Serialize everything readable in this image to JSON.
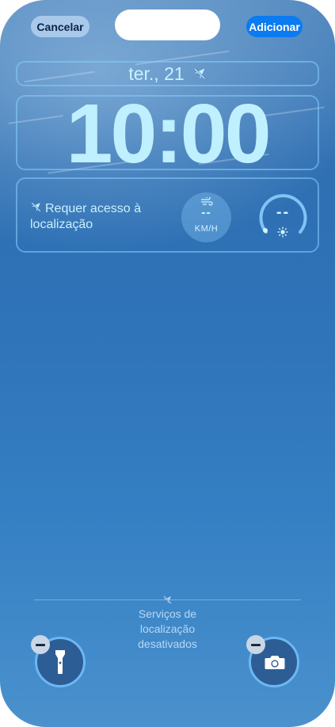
{
  "header": {
    "cancel_label": "Cancelar",
    "add_label": "Adicionar"
  },
  "lock_screen": {
    "date": "ter., 21",
    "time": "10:00"
  },
  "widgets": {
    "location_message": "Requer acesso à localização",
    "wind": {
      "value": "--",
      "unit": "KM/H"
    },
    "uv_gauge": {
      "value": "--"
    }
  },
  "footer": {
    "location_services_message": "Serviços de localização desativados"
  },
  "colors": {
    "accent_blue": "#0a7bf1",
    "cancel_bg": "#a9c9ea",
    "widget_text": "#c9f1ff"
  },
  "icons": {
    "date": "location-off-icon",
    "widget": "location-off-icon",
    "wind": "wind-icon",
    "gauge": "sun-icon",
    "left_action": "flashlight-icon",
    "right_action": "camera-icon"
  }
}
